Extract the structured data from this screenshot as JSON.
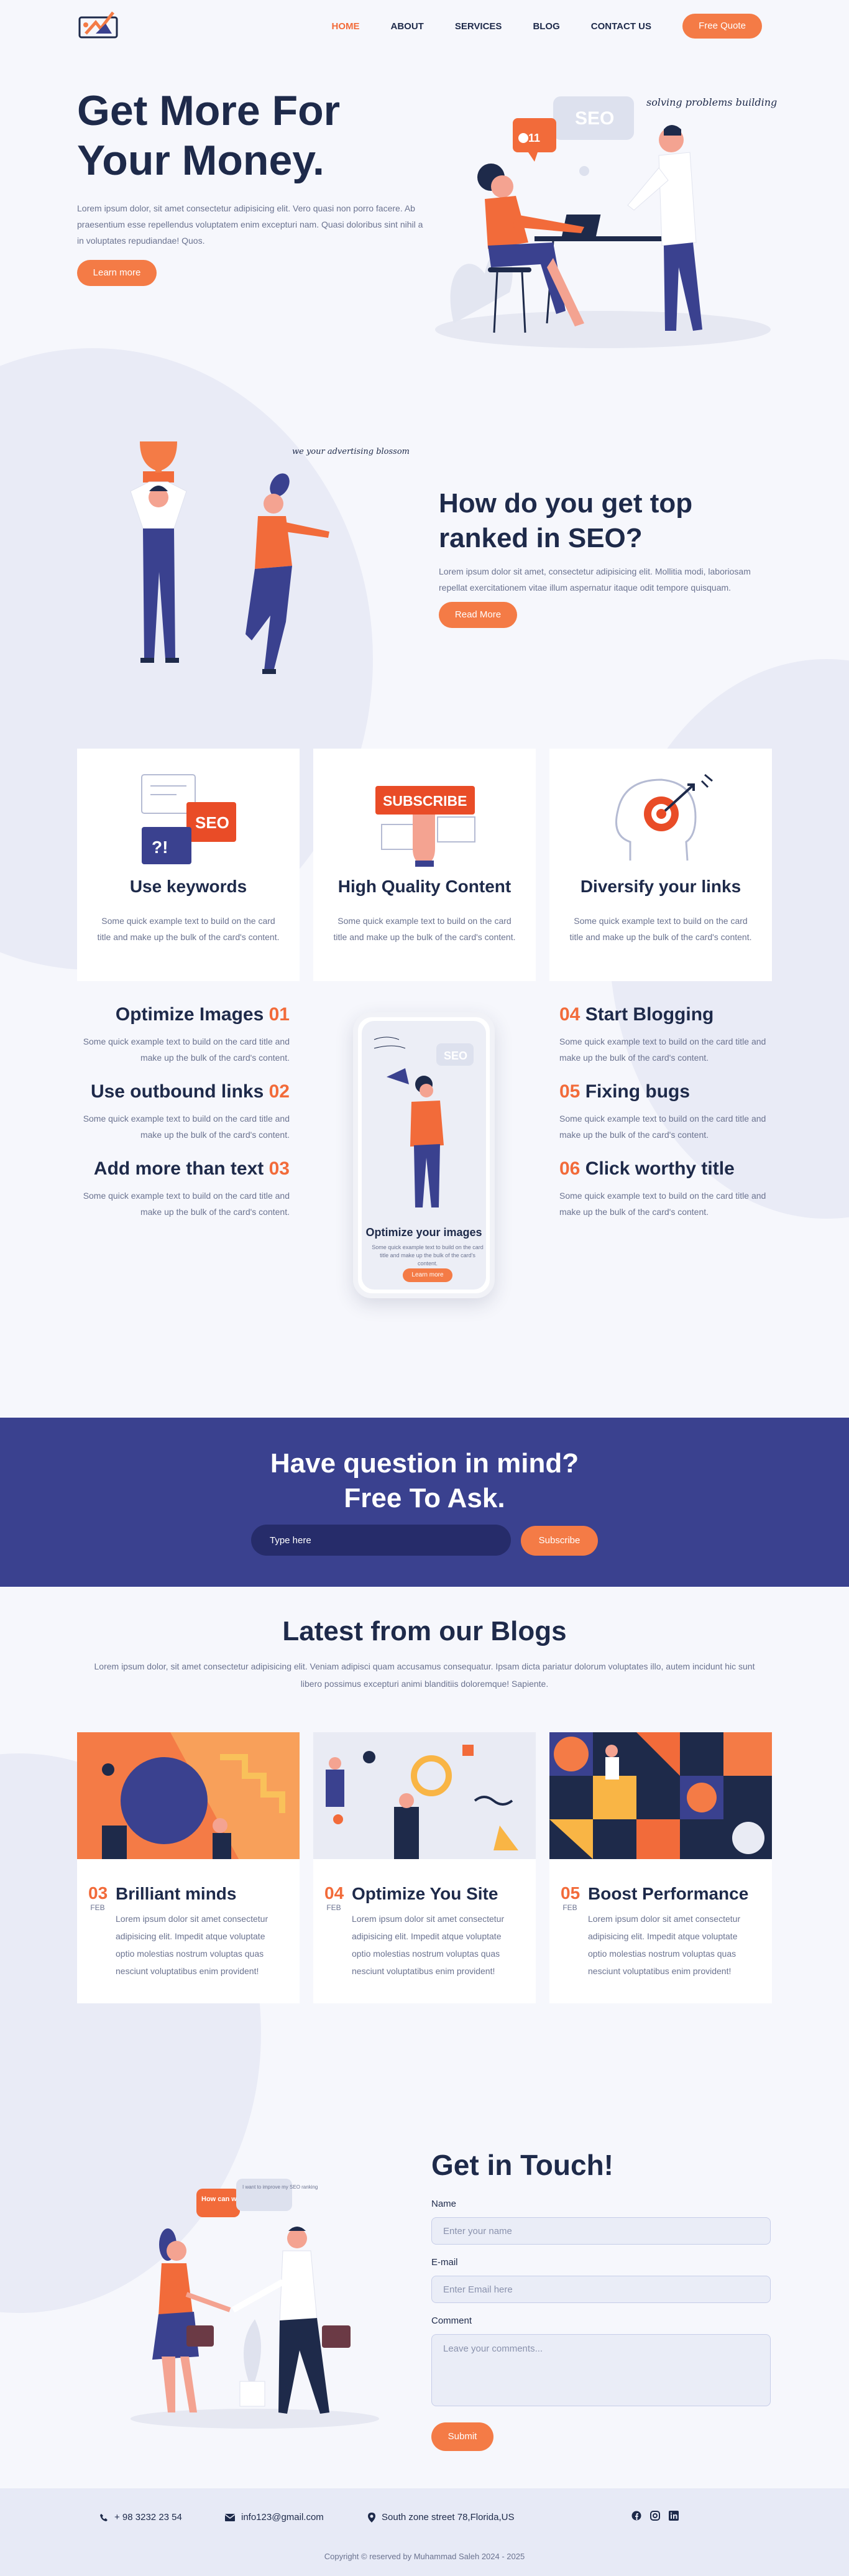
{
  "nav": {
    "items": [
      "HOME",
      "ABOUT",
      "SERVICES",
      "BLOG",
      "CONTACT US"
    ],
    "quote_label": "Free Quote"
  },
  "hero": {
    "title_line1": "Get More For",
    "title_line2": "Your Money.",
    "text": "Lorem ipsum dolor, sit amet consectetur adipisicing elit. Vero quasi non porro facere. Ab praesentium esse repellendus voluptatem enim excepturi nam. Quasi doloribus sint nihil a in voluptates repudiandae! Quos.",
    "button": "Learn more",
    "bubble_seo": "SEO",
    "bubble_count": "11",
    "handwriting": "solving problems building brands"
  },
  "seo": {
    "title": "How do you get top ranked in SEO?",
    "text": "Lorem ipsum dolor sit amet, consectetur adipisicing elit. Mollitia modi, laboriosam repellat exercitationem vitae illum aspernatur itaque odit tempore quisquam.",
    "button": "Read More",
    "handwriting": "we your advertising blossom"
  },
  "cards": [
    {
      "title": "Use keywords",
      "text": "Some quick example text to build on the card title and make up the bulk of the card's content.",
      "bubble": "SEO"
    },
    {
      "title": "High Quality Content",
      "text": "Some quick example text to build on the card title and make up the bulk of the card's content.",
      "sign": "SUBSCRIBE"
    },
    {
      "title": "Diversify your links",
      "text": "Some quick example text to build on the card title and make up the bulk of the card's content."
    }
  ],
  "features_left": [
    {
      "title": "Optimize Images",
      "num": "01",
      "text": "Some quick example text to build on the card title and make up the bulk of the card's content."
    },
    {
      "title": "Use outbound links",
      "num": "02",
      "text": "Some quick example text to build on the card title and make up the bulk of the card's content."
    },
    {
      "title": "Add more than text",
      "num": "03",
      "text": "Some quick example text to build on the card title and make up the bulk of the card's content."
    }
  ],
  "features_right": [
    {
      "title": "Start Blogging",
      "num": "04",
      "text": "Some quick example text to build on the card title and make up the bulk of the card's content."
    },
    {
      "title": "Fixing bugs",
      "num": "05",
      "text": "Some quick example text to build on the card title and make up the bulk of the card's content."
    },
    {
      "title": "Click worthy title",
      "num": "06",
      "text": "Some quick example text to build on the card title and make up the bulk of the card's content."
    }
  ],
  "phone": {
    "title": "Optimize your images",
    "text": "Some quick example text to build on the card title and make up the bulk of the card's content.",
    "button": "Learn more",
    "bubble": "SEO"
  },
  "subscribe": {
    "title_line1": "Have question in mind?",
    "title_line2": "Free To Ask.",
    "placeholder": "Type here",
    "button": "Subscribe"
  },
  "blogs": {
    "title": "Latest from our Blogs",
    "text": "Lorem ipsum dolor, sit amet consectetur adipisicing elit. Veniam adipisci quam accusamus consequatur. Ipsam dicta pariatur dolorum voluptates illo, autem incidunt hic sunt libero possimus excepturi animi blanditiis doloremque! Sapiente.",
    "posts": [
      {
        "day": "03",
        "month": "FEB",
        "title": "Brilliant minds",
        "text": "Lorem ipsum dolor sit amet consectetur adipisicing elit. Impedit atque voluptate optio molestias nostrum voluptas quas nesciunt voluptatibus enim provident!"
      },
      {
        "day": "04",
        "month": "FEB",
        "title": "Optimize You Site",
        "text": "Lorem ipsum dolor sit amet consectetur adipisicing elit. Impedit atque voluptate optio molestias nostrum voluptas quas nesciunt voluptatibus enim provident!"
      },
      {
        "day": "05",
        "month": "FEB",
        "title": "Boost Performance",
        "text": "Lorem ipsum dolor sit amet consectetur adipisicing elit. Impedit atque voluptate optio molestias nostrum voluptas quas nesciunt voluptatibus enim provident!"
      }
    ]
  },
  "contact": {
    "title": "Get in Touch!",
    "name_label": "Name",
    "name_placeholder": "Enter your name",
    "email_label": "E-mail",
    "email_placeholder": "Enter Email here",
    "comment_label": "Comment",
    "comment_placeholder": "Leave your comments...",
    "submit": "Submit",
    "bubble_left": "How can we help?",
    "bubble_right": "I want to improve my SEO ranking"
  },
  "footer": {
    "phone": "+ 98 3232 23 54",
    "email": "info123@gmail.com",
    "address": "South zone street 78,Florida,US",
    "copyright": "Copyright © reserved by Muhammad Saleh 2024 - 2025"
  },
  "colors": {
    "accent": "#f47b46",
    "navy": "#1e2a4a",
    "band": "#3a418f"
  }
}
